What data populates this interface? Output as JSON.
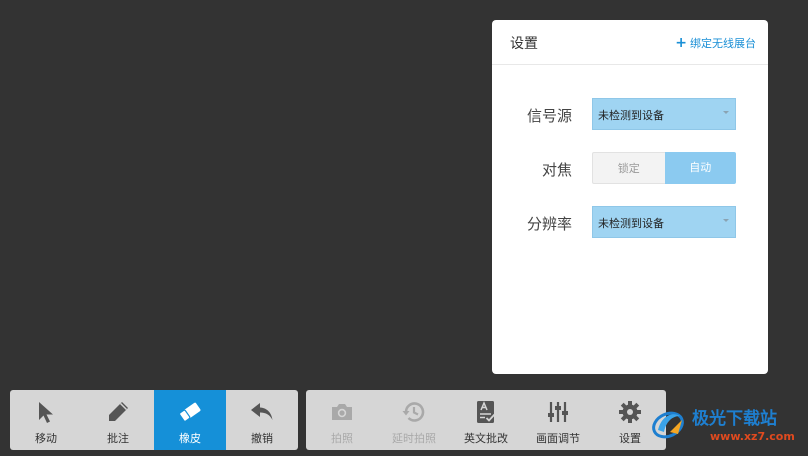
{
  "settings": {
    "title": "设置",
    "bind_link": "绑定无线展台",
    "signal_source": {
      "label": "信号源",
      "value": "未检测到设备"
    },
    "focus": {
      "label": "对焦",
      "options": [
        "锁定",
        "自动"
      ],
      "selected": "自动"
    },
    "resolution": {
      "label": "分辨率",
      "value": "未检测到设备"
    }
  },
  "toolbar_left": [
    {
      "label": "移动",
      "icon": "cursor-arrow-icon",
      "active": false,
      "disabled": false
    },
    {
      "label": "批注",
      "icon": "pencil-icon",
      "active": false,
      "disabled": false
    },
    {
      "label": "橡皮",
      "icon": "eraser-icon",
      "active": true,
      "disabled": false
    },
    {
      "label": "撤销",
      "icon": "undo-icon",
      "active": false,
      "disabled": false
    }
  ],
  "toolbar_right": [
    {
      "label": "拍照",
      "icon": "camera-icon",
      "active": false,
      "disabled": true
    },
    {
      "label": "延时拍照",
      "icon": "timer-history-icon",
      "active": false,
      "disabled": true
    },
    {
      "label": "英文批改",
      "icon": "grading-icon",
      "active": false,
      "disabled": false
    },
    {
      "label": "画面调节",
      "icon": "sliders-icon",
      "active": false,
      "disabled": false
    },
    {
      "label": "设置",
      "icon": "gear-icon",
      "active": false,
      "disabled": false
    }
  ],
  "watermark": {
    "title": "极光下载站",
    "url": "www.xz7.com"
  },
  "colors": {
    "background": "#333333",
    "accent": "#1590d8",
    "select_fill": "#9fd4f2",
    "toolbar": "#d6d6d6"
  }
}
